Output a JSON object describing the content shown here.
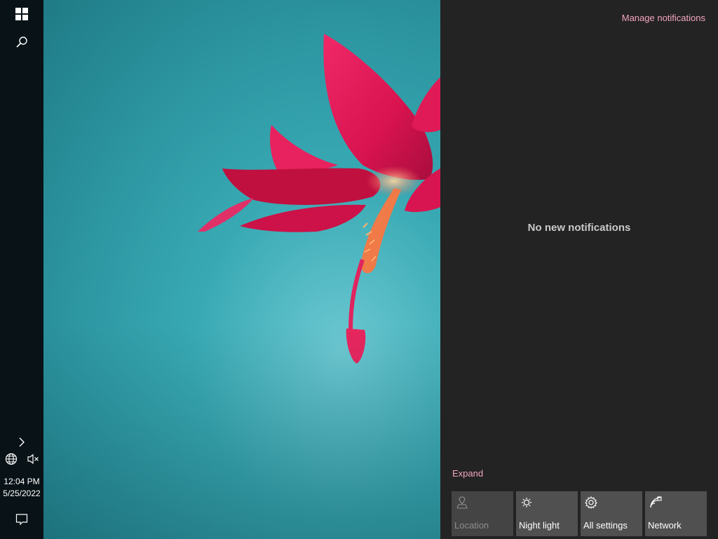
{
  "taskbar": {
    "start_icon": "windows-logo-icon",
    "search_icon": "search-icon",
    "overflow_icon": "chevron-right-icon",
    "network_icon": "globe-icon",
    "volume_icon": "speaker-muted-icon",
    "clock": {
      "time": "12:04 PM",
      "date": "5/25/2022"
    },
    "action_center_icon": "speech-bubble-icon"
  },
  "wallpaper": {
    "subject": "flower",
    "colors": {
      "sky": "#3aa9b3",
      "petal": "#d8134f"
    }
  },
  "action_center": {
    "manage_link": "Manage notifications",
    "empty_message": "No new notifications",
    "expand_link": "Expand",
    "quick_actions": [
      {
        "label": "Location",
        "icon": "location-icon",
        "enabled": false
      },
      {
        "label": "Night light",
        "icon": "night-light-icon",
        "enabled": true
      },
      {
        "label": "All settings",
        "icon": "gear-icon",
        "enabled": true
      },
      {
        "label": "Network",
        "icon": "network-icon",
        "enabled": true
      }
    ],
    "colors": {
      "panel_bg": "#232323",
      "link": "#f2a5bd",
      "tile_bg": "#505050"
    }
  }
}
